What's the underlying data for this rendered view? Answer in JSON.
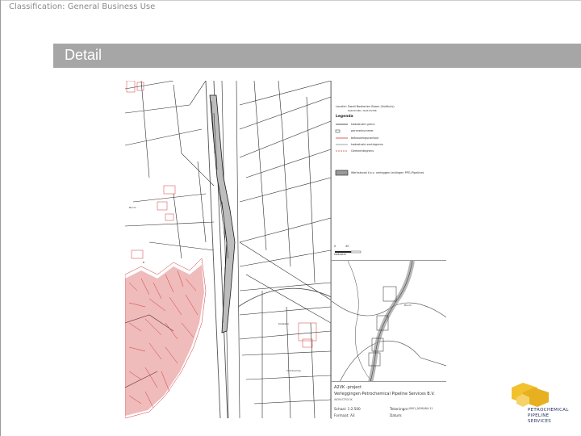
{
  "header": {
    "classification": "Classification: General Business Use",
    "title": "Detail"
  },
  "map": {
    "legend": {
      "location_label": "Locatie: Dwall Boekerlen Boom (Holthuis)",
      "coords": "6AR.DV.MK / RAZ.DV.MK",
      "title": "Legenda",
      "items": [
        {
          "label": "kadastrale grens",
          "symbol": "line-black"
        },
        {
          "label": "perceelnummer",
          "symbol": "box-small"
        },
        {
          "label": "bebouwingscontour",
          "symbol": "line-red"
        },
        {
          "label": "kadastrale sectiegrens",
          "symbol": "line-grey"
        },
        {
          "label": "Gemeentegrens",
          "symbol": "line-red-dashed"
        },
        {
          "label": "Werkstrook t.b.v. verleggen leidingen PPG-Pipelines",
          "symbol": "hatch-box"
        }
      ],
      "scale_labels": [
        "0",
        "40"
      ],
      "scale_unit": "kadaster"
    },
    "title_block": {
      "project": "A2VK -project",
      "company": "Verleggingen Petrochemical Pipeline Services B.V.",
      "subtitle": "WERKSTROOK",
      "scale": "Schaal: 1:2.500",
      "format": "Formaat: A3",
      "drawing_no_label": "Tekeningnr:",
      "drawing_no": "0001_A2VK-W4-11",
      "date_label": "Datum:"
    },
    "colors": {
      "parcel_red": "#d23b3b",
      "line_dark": "#2b2b2b",
      "line_grey": "#8a8a8a"
    }
  },
  "logo": {
    "lines": [
      "PETROCHEMICAL",
      "PIPELINE",
      "SERVICES"
    ],
    "colors": {
      "yellow": "#f2c12e",
      "navy": "#1c2b5a"
    }
  }
}
